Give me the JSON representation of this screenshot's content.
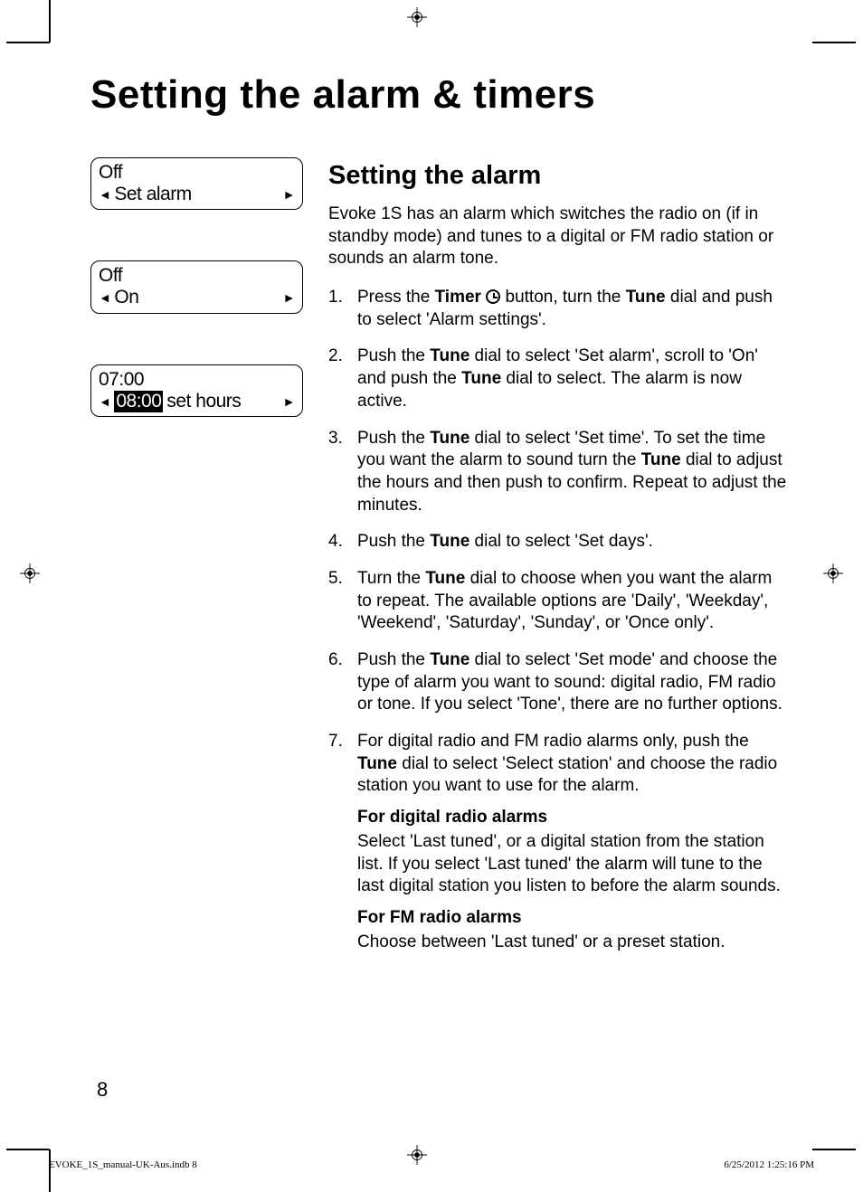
{
  "title": "Setting the alarm & timers",
  "section_heading": "Setting the alarm",
  "intro": "Evoke 1S has an alarm which switches the radio on (if in standby mode) and tunes to a digital or FM radio station or sounds an alarm tone.",
  "lcd": {
    "box1": {
      "line1": "Off",
      "line2": "Set alarm"
    },
    "box2": {
      "line1": "Off",
      "line2": "On"
    },
    "box3": {
      "line1": "07:00",
      "line2_highlight": "08:00",
      "line2_rest": " set hours"
    }
  },
  "steps": [
    {
      "n": "1.",
      "pre": "Press the ",
      "b1": "Timer",
      "mid1": " ",
      "icon": true,
      "mid2": " button, turn the ",
      "b2": "Tune",
      "post": " dial and push to select 'Alarm settings'."
    },
    {
      "n": "2.",
      "pre": "Push the ",
      "b1": "Tune",
      "mid1": " dial to select 'Set alarm', scroll to 'On' and push the ",
      "b2": "Tune",
      "post": " dial to select. The alarm is now active."
    },
    {
      "n": "3.",
      "pre": "Push the ",
      "b1": "Tune",
      "mid1": " dial to select 'Set time'. To set the time you want the alarm to sound turn the ",
      "b2": "Tune",
      "post": " dial to adjust the hours and then push to confirm. Repeat to adjust the minutes."
    },
    {
      "n": "4.",
      "pre": "Push the ",
      "b1": "Tune",
      "post": " dial to select 'Set days'."
    },
    {
      "n": "5.",
      "pre": "Turn the ",
      "b1": "Tune",
      "post": " dial to choose when you want the alarm to repeat. The available options are 'Daily', 'Weekday', 'Weekend', 'Saturday', 'Sunday', or 'Once only'."
    },
    {
      "n": "6.",
      "pre": "Push the ",
      "b1": "Tune",
      "post": " dial to select 'Set mode' and choose the type of alarm you want to sound: digital radio, FM radio or tone. If you select 'Tone', there are no further options."
    },
    {
      "n": "7.",
      "pre": "For digital radio and FM radio alarms only, push the ",
      "b1": "Tune",
      "post": " dial to select 'Select station' and choose the radio station you want to use for the alarm.",
      "sub1_head": "For digital radio alarms",
      "sub1_body": "Select 'Last tuned', or a digital station from the station list. If you select 'Last tuned' the alarm will tune to the last digital station you listen to before the alarm sounds.",
      "sub2_head": "For FM radio alarms",
      "sub2_body": "Choose between 'Last tuned' or a preset station."
    }
  ],
  "page_number": "8",
  "footer_left": "EVOKE_1S_manual-UK-Aus.indb   8",
  "footer_right": "6/25/2012   1:25:16 PM"
}
